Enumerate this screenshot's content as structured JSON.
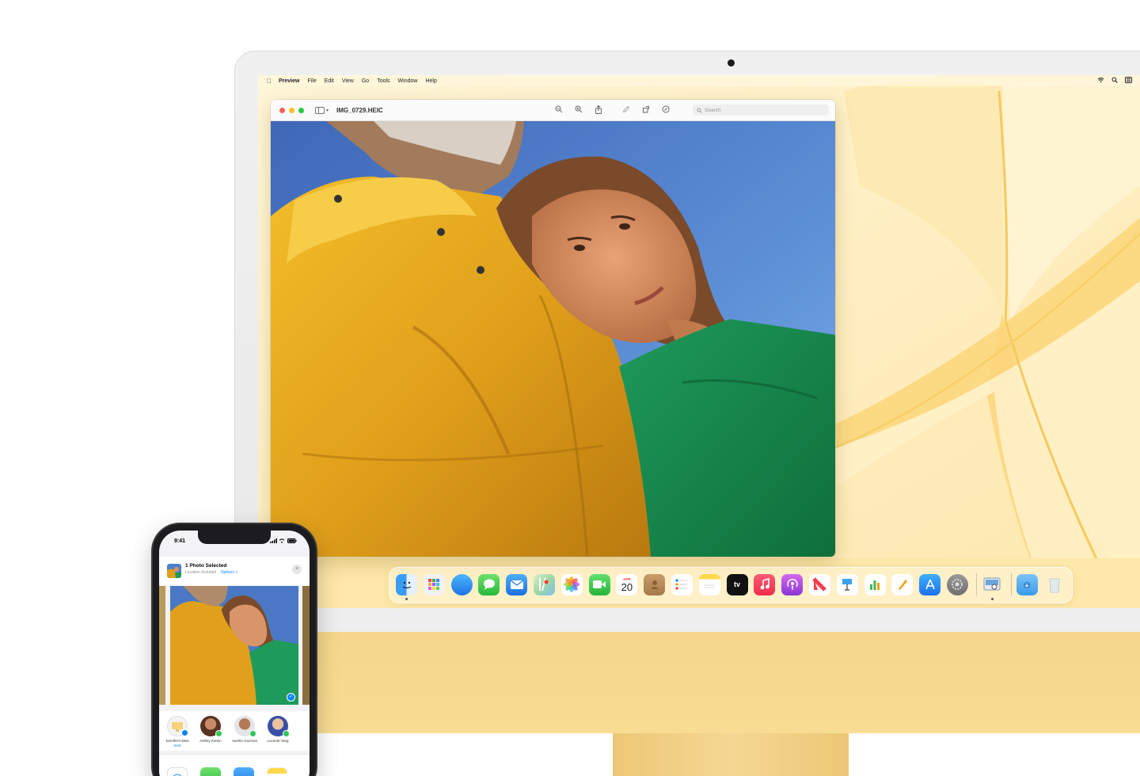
{
  "menubar": {
    "apple": "",
    "items": [
      "Preview",
      "File",
      "Edit",
      "View",
      "Go",
      "Tools",
      "Window",
      "Help"
    ],
    "status_icons": [
      "wifi-icon",
      "spotlight-icon",
      "control-center-icon"
    ]
  },
  "preview_window": {
    "title": "IMG_0729.HEIC",
    "search_placeholder": "Search",
    "toolbar_icons": [
      "zoom-out-icon",
      "zoom-in-icon",
      "share-icon",
      "markup-icon",
      "rotate-icon",
      "annotate-icon"
    ]
  },
  "dock": {
    "calendar": {
      "month": "APR",
      "day": "20"
    },
    "tv_label": "tv",
    "apps": [
      "Finder",
      "Launchpad",
      "Safari",
      "Messages",
      "Mail",
      "Maps",
      "Photos",
      "FaceTime",
      "Calendar",
      "Contacts",
      "Reminders",
      "Notes",
      "TV",
      "Music",
      "Podcasts",
      "News",
      "Keynote",
      "Numbers",
      "Pages",
      "App Store",
      "System Preferences",
      "Preview",
      "Downloads",
      "Trash"
    ]
  },
  "iphone": {
    "time": "9:41",
    "share_sheet": {
      "title": "1 Photo Selected",
      "subtitle": "Location Included",
      "options_label": "Options >",
      "close": "×"
    },
    "people": [
      {
        "name": "Jennifer's iMac",
        "sub": "Sent"
      },
      {
        "name": "Ashley Kamin",
        "sub": ""
      },
      {
        "name": "Aurelio Guzman",
        "sub": ""
      },
      {
        "name": "Lucinda Yang",
        "sub": ""
      }
    ]
  },
  "colors": {
    "wallpaper": "#fdf2cf",
    "chin": "#f6d78a",
    "accent_blue": "#0a84ff"
  }
}
